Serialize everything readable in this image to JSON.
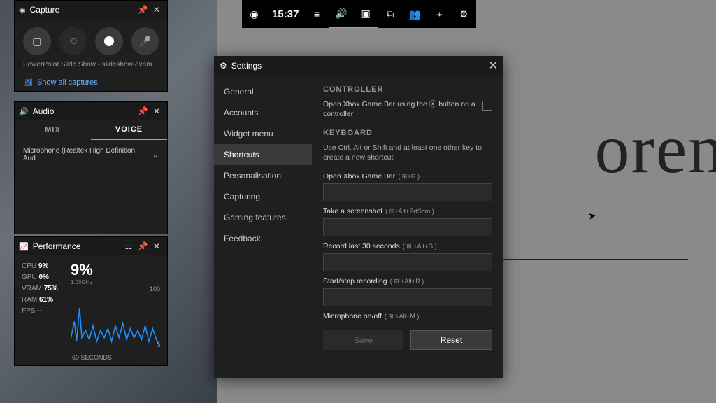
{
  "background": {
    "text": "orem"
  },
  "topbar": {
    "clock": "15:37",
    "icons": [
      "xbox",
      "clock",
      "menu",
      "volume",
      "monitor",
      "perf",
      "social",
      "mouse",
      "gear"
    ]
  },
  "capture": {
    "title": "Capture",
    "subtitle": "PowerPoint Slide Show - slideshow-exam...",
    "link": "Show all captures"
  },
  "audio": {
    "title": "Audio",
    "tabs": {
      "mix": "MIX",
      "voice": "VOICE"
    },
    "device": "Microphone (Realtek High Definition Aud..."
  },
  "performance": {
    "title": "Performance",
    "big": "9%",
    "ghz": "1.00GHz",
    "stats": {
      "cpu_label": "CPU",
      "cpu": "9%",
      "gpu_label": "GPU",
      "gpu": "0%",
      "vram_label": "VRAM",
      "vram": "75%",
      "ram_label": "RAM",
      "ram": "61%",
      "fps_label": "FPS",
      "fps": "--"
    },
    "axis": {
      "top": "100",
      "bottom": "0",
      "label": "60 SECONDS"
    }
  },
  "settings": {
    "title": "Settings",
    "nav": {
      "general": "General",
      "accounts": "Accounts",
      "widget": "Widget menu",
      "shortcuts": "Shortcuts",
      "personal": "Personalisation",
      "capturing": "Capturing",
      "gaming": "Gaming features",
      "feedback": "Feedback"
    },
    "controller": {
      "heading": "CONTROLLER",
      "text_a": "Open Xbox Game Bar using the",
      "text_b": "button on a controller"
    },
    "keyboard": {
      "heading": "KEYBOARD",
      "hint": "Use Ctrl, Alt or Shift and at least one other key to create a new shortcut",
      "fields": {
        "open": {
          "label": "Open Xbox Game Bar",
          "sc": "( ⊞+G )"
        },
        "shot": {
          "label": "Take a screenshot",
          "sc": "( ⊞+Alt+PrtScrn )"
        },
        "rec30": {
          "label": "Record last 30 seconds",
          "sc": "( ⊞ +Alt+G )"
        },
        "rec": {
          "label": "Start/stop recording",
          "sc": "( ⊞ +Alt+R )"
        },
        "mic": {
          "label": "Microphone on/off",
          "sc": "( ⊞ +Alt+M )"
        }
      },
      "save": "Save",
      "reset": "Reset"
    }
  }
}
